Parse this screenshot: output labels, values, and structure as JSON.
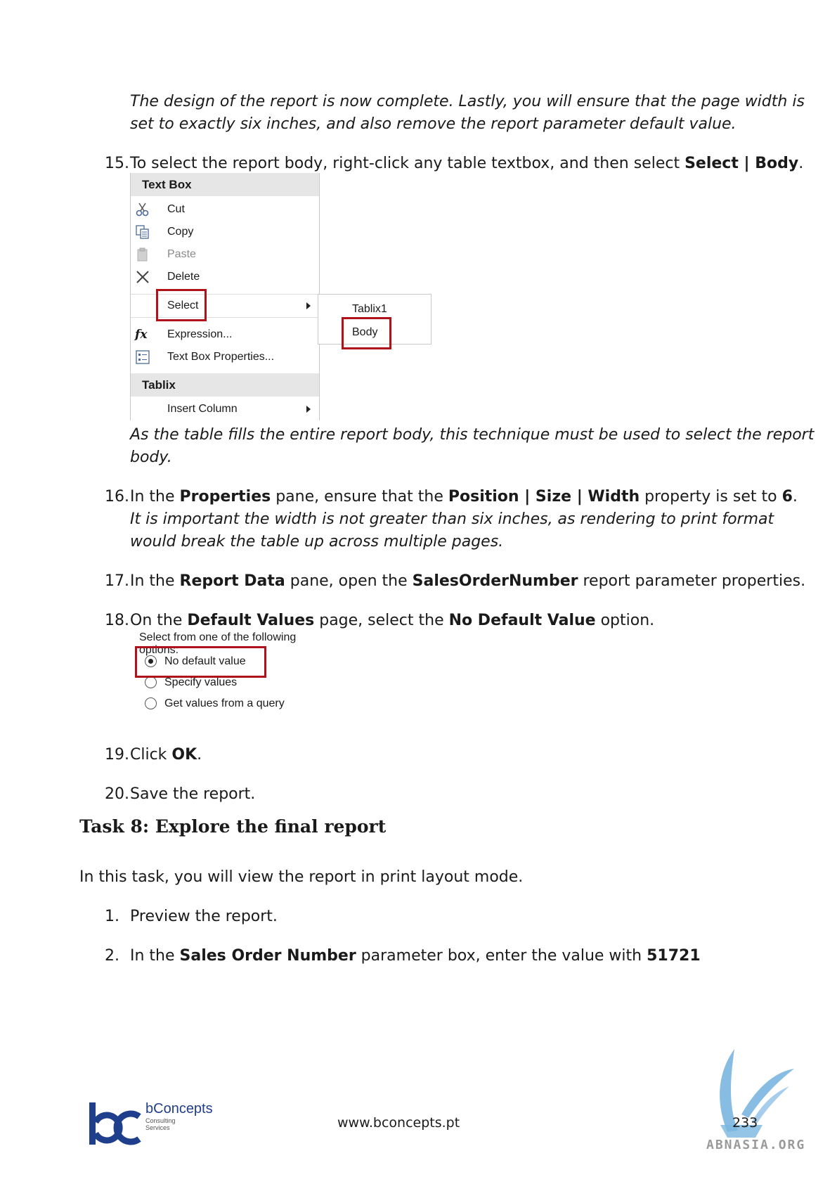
{
  "intro_note": {
    "line1": "The design of the report is now complete. Lastly, you will ensure that the page width is",
    "line2": "set to exactly six inches, and also remove the report parameter default value."
  },
  "steps": {
    "s15": {
      "num": "15.",
      "pre": "To select the report body, right-click any table textbox, and then select ",
      "bold": "Select | Body",
      "post": "."
    },
    "s15_note": {
      "line1": "As the table fills the entire report body, this technique must be used to select the report",
      "line2": "body."
    },
    "s16": {
      "num": "16.",
      "a": "In the ",
      "b1": "Properties",
      "c": " pane, ensure that the ",
      "b2": "Position | Size | Width",
      "d": " property is set to ",
      "b3": "6",
      "e": "."
    },
    "s16_note": {
      "line1": "It is important the width is not greater than six inches, as rendering to print format",
      "line2": "would break the table up across multiple pages."
    },
    "s17": {
      "num": "17.",
      "a": "In the ",
      "b1": "Report Data",
      "c": " pane, open the ",
      "b2": "SalesOrderNumber",
      "d": " report parameter properties."
    },
    "s18": {
      "num": "18.",
      "a": "On the ",
      "b1": "Default Values",
      "c": " page, select the ",
      "b2": "No Default Value",
      "d": " option."
    },
    "s19": {
      "num": "19.",
      "a": "Click ",
      "b1": "OK",
      "c": "."
    },
    "s20": {
      "num": "20.",
      "a": "Save the report."
    }
  },
  "context_menu": {
    "header_textbox": "Text Box",
    "items": [
      "Cut",
      "Copy",
      "Paste",
      "Delete",
      "Select",
      "Expression...",
      "Text Box Properties..."
    ],
    "header_tablix": "Tablix",
    "insert_column": "Insert Column",
    "submenu": [
      "Tablix1",
      "Body"
    ]
  },
  "radio_group": {
    "title": "Select from one of the following options:",
    "options": [
      "No default value",
      "Specify values",
      "Get values from a query"
    ],
    "selected": "No default value"
  },
  "task8": {
    "title": "Task 8: Explore the final report",
    "intro": "In this task, you will view the report in print layout mode.",
    "s1": {
      "num": "1.",
      "a": "Preview the report."
    },
    "s2": {
      "num": "2.",
      "a": "In the ",
      "b1": "Sales Order Number",
      "c": " parameter box, enter the value with ",
      "b2": "51721"
    }
  },
  "footer": {
    "brand": "bConcepts",
    "brand_sub1": "Consulting",
    "brand_sub2": "Services",
    "url": "www.bconcepts.pt",
    "page": "233",
    "watermark": "ABNASIA.ORG"
  },
  "colors": {
    "highlight_red": "#b0121b",
    "logo_blue": "#1f3e8c",
    "watermark_blue": "#7ab6e0"
  }
}
